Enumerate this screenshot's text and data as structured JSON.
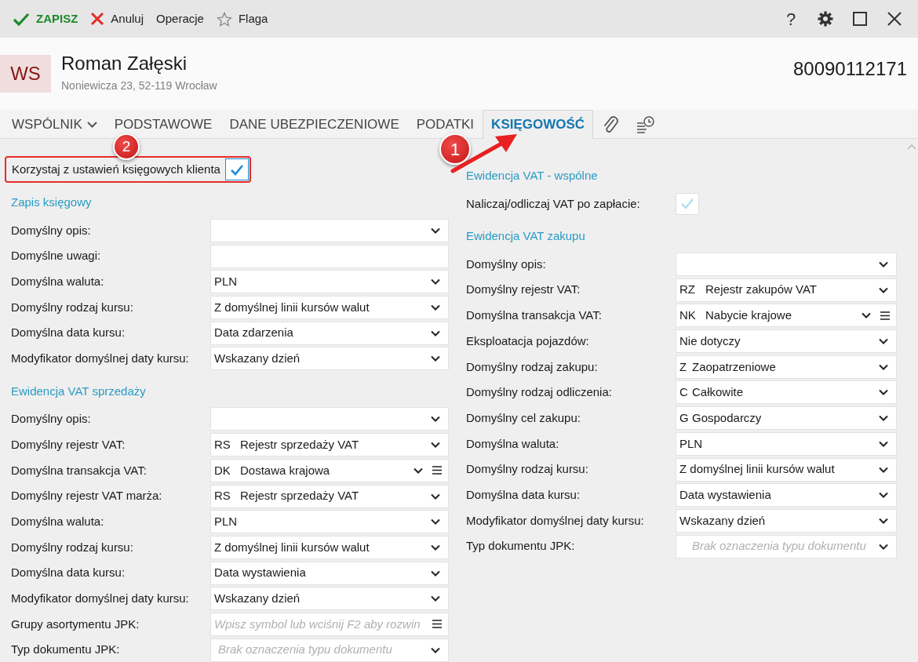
{
  "toolbar": {
    "actions": [
      {
        "kind": "save",
        "label": "ZAPISZ"
      },
      {
        "kind": "cancel",
        "label": "Anuluj"
      },
      {
        "kind": "plain",
        "label": "Operacje"
      },
      {
        "kind": "flag",
        "label": "Flaga"
      }
    ],
    "window_buttons": [
      {
        "kind": "help",
        "label": "?"
      },
      {
        "kind": "settings"
      },
      {
        "kind": "maximize"
      },
      {
        "kind": "close"
      }
    ]
  },
  "header": {
    "initials": "WS",
    "name": "Roman Załęski",
    "address": "Noniewicza 23, 52-119 Wrocław",
    "number": "80090112171"
  },
  "tabs": [
    {
      "kind": "dropdown",
      "label": "WSPÓLNIK",
      "selected": false
    },
    {
      "kind": "text",
      "label": "PODSTAWOWE",
      "selected": false
    },
    {
      "kind": "text",
      "label": "DANE UBEZPIECZENIOWE",
      "selected": false
    },
    {
      "kind": "text",
      "label": "PODATKI",
      "selected": false
    },
    {
      "kind": "text",
      "label": "KSIĘGOWOŚĆ",
      "selected": true
    },
    {
      "kind": "attachment",
      "selected": false
    },
    {
      "kind": "history",
      "selected": false
    }
  ],
  "use_client_settings": {
    "label": "Korzystaj z ustawień księgowych klienta",
    "checked": true
  },
  "left_sections": [
    {
      "title": "Zapis księgowy",
      "fields": [
        {
          "kind": "select",
          "label": "Domyślny opis:"
        },
        {
          "kind": "text",
          "label": "Domyślne uwagi:"
        },
        {
          "kind": "select",
          "label": "Domyślna waluta:",
          "value": "PLN"
        },
        {
          "kind": "select",
          "label": "Domyślny rodzaj kursu:",
          "value": "Z domyślnej linii kursów walut"
        },
        {
          "kind": "select",
          "label": "Domyślna data kursu:",
          "value": "Data zdarzenia"
        },
        {
          "kind": "select",
          "label": "Modyfikator domyślnej daty kursu:",
          "value": "Wskazany dzień"
        }
      ]
    },
    {
      "title": "Ewidencja VAT sprzedaży",
      "fields": [
        {
          "kind": "select",
          "label": "Domyślny opis:"
        },
        {
          "kind": "select",
          "label": "Domyślny rejestr VAT:",
          "code": "RS",
          "value": "Rejestr sprzedaży VAT"
        },
        {
          "kind": "select_list",
          "label": "Domyślna transakcja VAT:",
          "code": "DK",
          "value": "Dostawa krajowa"
        },
        {
          "kind": "select",
          "label": "Domyślny rejestr VAT marża:",
          "code": "RS",
          "value": "Rejestr sprzedaży VAT"
        },
        {
          "kind": "select",
          "label": "Domyślna waluta:",
          "value": "PLN"
        },
        {
          "kind": "select",
          "label": "Domyślny rodzaj kursu:",
          "value": "Z domyślnej linii kursów walut"
        },
        {
          "kind": "select",
          "label": "Domyślna data kursu:",
          "value": "Data wystawienia"
        },
        {
          "kind": "select",
          "label": "Modyfikator domyślnej daty kursu:",
          "value": "Wskazany dzień"
        },
        {
          "kind": "lookup",
          "label": "Grupy asortymentu JPK:",
          "placeholder": "Wpisz symbol lub wciśnij F2 aby rozwin"
        },
        {
          "kind": "select",
          "label": "Typ dokumentu JPK:",
          "placeholder": "Brak oznaczenia typu dokumentu"
        }
      ]
    }
  ],
  "right_sections": [
    {
      "title": "Ewidencja VAT - wspólne",
      "fields": [
        {
          "kind": "checkbox",
          "label": "Naliczaj/odliczaj VAT po zapłacie:",
          "checked": true,
          "disabled": true
        }
      ]
    },
    {
      "title": "Ewidencja VAT zakupu",
      "fields": [
        {
          "kind": "select",
          "label": "Domyślny opis:"
        },
        {
          "kind": "select",
          "label": "Domyślny rejestr VAT:",
          "code": "RZ",
          "value": "Rejestr zakupów VAT"
        },
        {
          "kind": "select_list",
          "label": "Domyślna transakcja VAT:",
          "code": "NK",
          "value": "Nabycie krajowe"
        },
        {
          "kind": "select",
          "label": "Eksploatacja pojazdów:",
          "value": "Nie dotyczy"
        },
        {
          "kind": "select",
          "label": "Domyślny rodzaj zakupu:",
          "code": "Z",
          "value": "Zaopatrzeniowe"
        },
        {
          "kind": "select",
          "label": "Domyślny rodzaj odliczenia:",
          "code": "C",
          "value": "Całkowite"
        },
        {
          "kind": "select",
          "label": "Domyślny cel zakupu:",
          "code": "G",
          "value": "Gospodarczy"
        },
        {
          "kind": "select",
          "label": "Domyślna waluta:",
          "value": "PLN"
        },
        {
          "kind": "select",
          "label": "Domyślny rodzaj kursu:",
          "value": "Z domyślnej linii kursów walut"
        },
        {
          "kind": "select",
          "label": "Domyślna data kursu:",
          "value": "Data wystawienia"
        },
        {
          "kind": "select",
          "label": "Modyfikator domyślnej daty kursu:",
          "value": "Wskazany dzień"
        },
        {
          "kind": "select",
          "label": "Typ dokumentu JPK:",
          "placeholder": "Brak oznaczenia typu dokumentu"
        }
      ]
    }
  ],
  "annotations": [
    {
      "number": "2",
      "arrow": false
    },
    {
      "number": "1",
      "arrow": true
    }
  ]
}
